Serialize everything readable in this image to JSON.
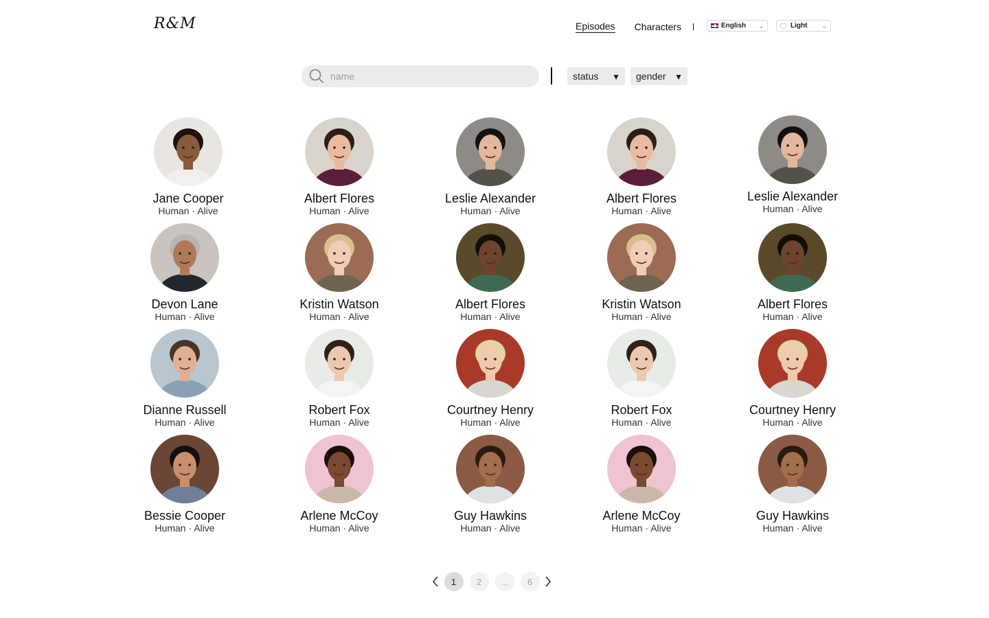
{
  "header": {
    "logo": "R&M",
    "nav": [
      {
        "label": "Episodes",
        "active": true
      },
      {
        "label": "Characters",
        "active": false
      }
    ],
    "language": "English",
    "theme": "Light"
  },
  "search": {
    "placeholder": "name",
    "value": ""
  },
  "filters": {
    "status": "status",
    "gender": "gender"
  },
  "characters": [
    {
      "name": "Jane Cooper",
      "sub": "Human · Alive",
      "skin": "#8a5a3c",
      "hair": "#1c120b",
      "bg": "#e9e6e1",
      "shirt": "#f1f0ec"
    },
    {
      "name": "Albert Flores",
      "sub": "Human · Alive",
      "skin": "#e9b9a0",
      "hair": "#2a1e16",
      "bg": "#d8d4cc",
      "shirt": "#5b1e3a"
    },
    {
      "name": "Leslie Alexander",
      "sub": "Human · Alive",
      "skin": "#e2b79b",
      "hair": "#111111",
      "bg": "#8e8a86",
      "shirt": "#555048"
    },
    {
      "name": "Albert Flores",
      "sub": "Human · Alive",
      "skin": "#e9b9a0",
      "hair": "#2a1e16",
      "bg": "#d8d4cc",
      "shirt": "#5b1e3a"
    },
    {
      "name": "Leslie Alexander",
      "sub": "Human · Alive",
      "skin": "#e2b79b",
      "hair": "#111111",
      "bg": "#8e8a86",
      "shirt": "#555048"
    },
    {
      "name": "Devon Lane",
      "sub": "Human · Alive",
      "skin": "#b07a58",
      "hair": "#b8b4b0",
      "bg": "#c9c4bf",
      "shirt": "#23272d"
    },
    {
      "name": "Kristin Watson",
      "sub": "Human · Alive",
      "skin": "#f0cdb6",
      "hair": "#d8c08e",
      "bg": "#9c6b54",
      "shirt": "#6e6450"
    },
    {
      "name": "Albert Flores",
      "sub": "Human · Alive",
      "skin": "#6e4430",
      "hair": "#150d08",
      "bg": "#5a4a2a",
      "shirt": "#3e6a54"
    },
    {
      "name": "Kristin Watson",
      "sub": "Human · Alive",
      "skin": "#f0cdb6",
      "hair": "#d8c08e",
      "bg": "#9c6b54",
      "shirt": "#6e6450"
    },
    {
      "name": "Albert Flores",
      "sub": "Human · Alive",
      "skin": "#6e4430",
      "hair": "#150d08",
      "bg": "#5a4a2a",
      "shirt": "#3e6a54"
    },
    {
      "name": "Dianne Russell",
      "sub": "Human · Alive",
      "skin": "#e0b095",
      "hair": "#4a3424",
      "bg": "#b9c6cf",
      "shirt": "#8aa0b4"
    },
    {
      "name": "Robert Fox",
      "sub": "Human · Alive",
      "skin": "#edc8b0",
      "hair": "#2d211a",
      "bg": "#e8ece6",
      "shirt": "#f4f4f2"
    },
    {
      "name": "Courtney Henry",
      "sub": "Human · Alive",
      "skin": "#f1c9ae",
      "hair": "#e4d3a8",
      "bg": "#a93a2a",
      "shirt": "#d9d6d0"
    },
    {
      "name": "Robert Fox",
      "sub": "Human · Alive",
      "skin": "#edc8b0",
      "hair": "#2d211a",
      "bg": "#e8ece6",
      "shirt": "#f4f4f2"
    },
    {
      "name": "Courtney Henry",
      "sub": "Human · Alive",
      "skin": "#f1c9ae",
      "hair": "#e4d3a8",
      "bg": "#a93a2a",
      "shirt": "#d9d6d0"
    },
    {
      "name": "Bessie Cooper",
      "sub": "Human · Alive",
      "skin": "#c98f6c",
      "hair": "#111111",
      "bg": "#6b4634",
      "shirt": "#6f7f99"
    },
    {
      "name": "Arlene McCoy",
      "sub": "Human · Alive",
      "skin": "#7a4a30",
      "hair": "#1a0f0a",
      "bg": "#efc3d2",
      "shirt": "#c9b8a8"
    },
    {
      "name": "Guy Hawkins",
      "sub": "Human · Alive",
      "skin": "#a46d4b",
      "hair": "#2a1a10",
      "bg": "#8a5a44",
      "shirt": "#dfe2e4"
    },
    {
      "name": "Arlene McCoy",
      "sub": "Human · Alive",
      "skin": "#7a4a30",
      "hair": "#1a0f0a",
      "bg": "#efc3d2",
      "shirt": "#c9b8a8"
    },
    {
      "name": "Guy Hawkins",
      "sub": "Human · Alive",
      "skin": "#a46d4b",
      "hair": "#2a1a10",
      "bg": "#8a5a44",
      "shirt": "#dfe2e4"
    }
  ],
  "pagination": {
    "pages": [
      "1",
      "2",
      "...",
      "6"
    ],
    "current": "1"
  }
}
